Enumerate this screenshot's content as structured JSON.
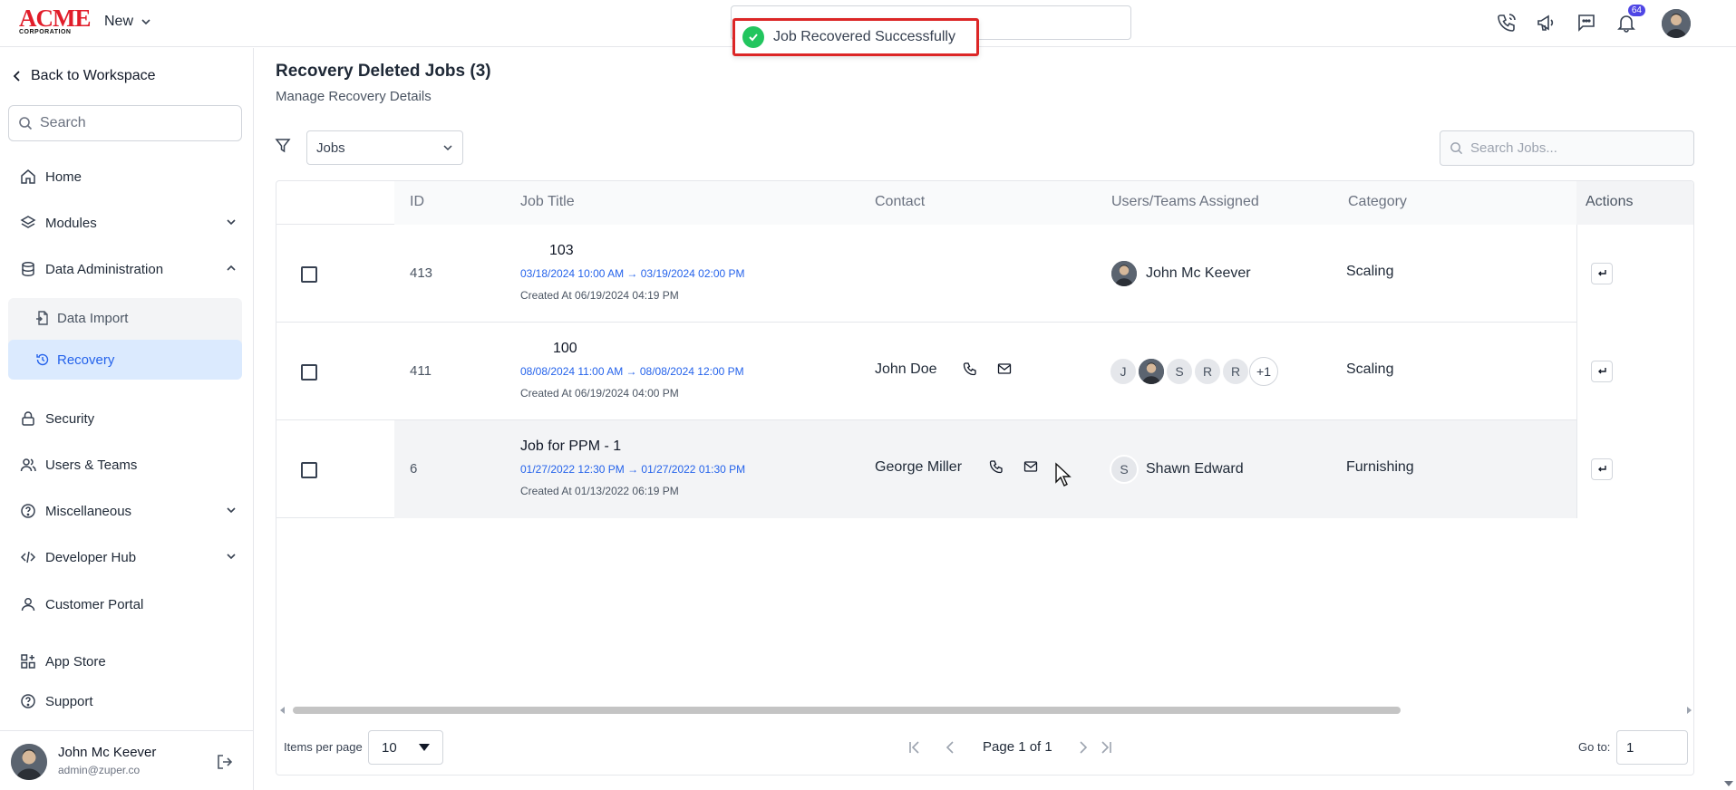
{
  "topbar": {
    "logo_main": "ACME",
    "logo_sub": "CORPORATION",
    "new_label": "New",
    "notification_count": "64"
  },
  "toast": {
    "message": "Job Recovered Successfully"
  },
  "sidebar": {
    "back_label": "Back to Workspace",
    "search_placeholder": "Search",
    "items": {
      "home": "Home",
      "modules": "Modules",
      "data_admin": "Data Administration",
      "data_import": "Data Import",
      "recovery": "Recovery",
      "security": "Security",
      "users_teams": "Users & Teams",
      "misc": "Miscellaneous",
      "dev_hub": "Developer Hub",
      "customer_portal": "Customer Portal",
      "app_store": "App Store",
      "support": "Support"
    },
    "user": {
      "name": "John Mc Keever",
      "email": "admin@zuper.co"
    }
  },
  "main": {
    "title": "Recovery Deleted Jobs (3)",
    "subtitle": "Manage Recovery Details",
    "filter_select": "Jobs",
    "search_placeholder": "Search Jobs...",
    "columns": {
      "id": "ID",
      "job_title": "Job Title",
      "contact": "Contact",
      "assigned": "Users/Teams Assigned",
      "category": "Category",
      "actions": "Actions"
    },
    "rows": [
      {
        "id": "413",
        "title": "103",
        "dates": "03/18/2024 10:00 AM → 03/19/2024 02:00 PM",
        "created": "Created At 06/19/2024 04:19 PM",
        "contact": "",
        "assignee": "John Mc Keever",
        "category": "Scaling"
      },
      {
        "id": "411",
        "title": "100",
        "dates": "08/08/2024 11:00 AM → 08/08/2024 12:00 PM",
        "created": "Created At 06/19/2024 04:00 PM",
        "contact": "John Doe",
        "avatars": [
          "J",
          "",
          "S",
          "R",
          "R",
          "+1"
        ],
        "category": "Scaling"
      },
      {
        "id": "6",
        "title": "Job for PPM - 1",
        "dates": "01/27/2022 12:30 PM → 01/27/2022 01:30 PM",
        "created": "Created At 01/13/2022 06:19 PM",
        "contact": "George Miller",
        "assignee_initial": "S",
        "assignee": "Shawn Edward",
        "category": "Furnishing"
      }
    ],
    "pager": {
      "items_per_page_label": "Items per page",
      "items_per_page": "10",
      "page_info": "Page 1 of 1",
      "goto_label": "Go to:",
      "goto_value": "1"
    }
  },
  "colors": {
    "accent": "#2563eb",
    "toast_border": "#dc2626",
    "success": "#22c55e",
    "badge": "#4f46e5"
  }
}
